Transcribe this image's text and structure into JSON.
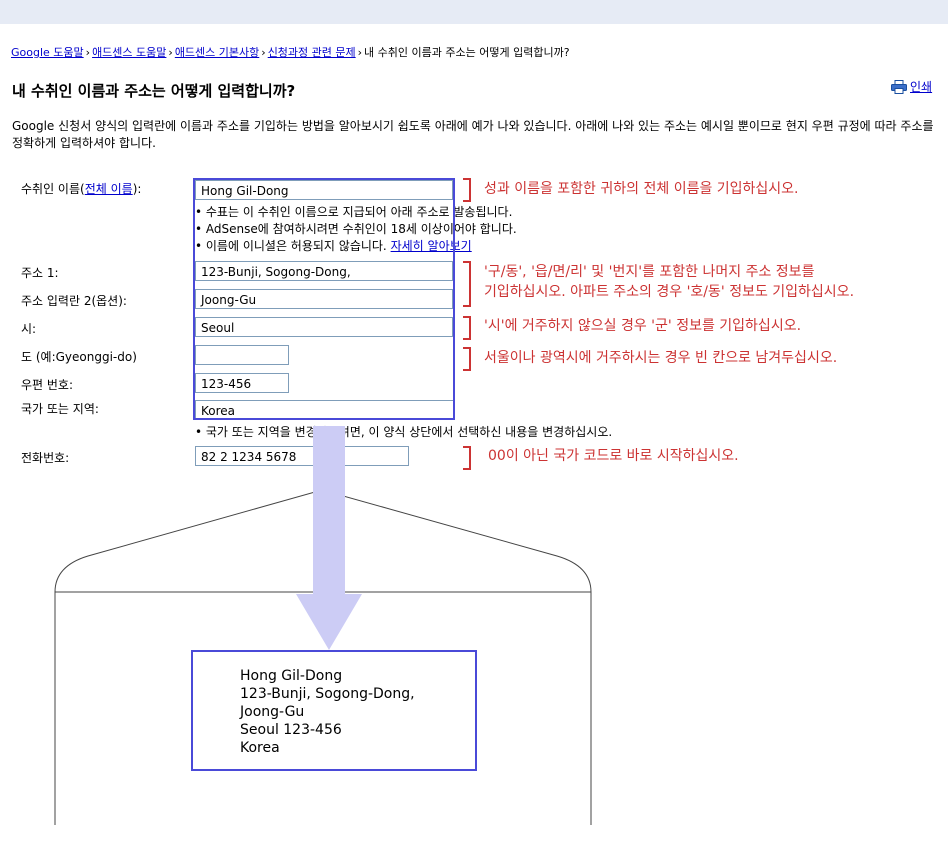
{
  "breadcrumb": {
    "items": [
      "Google 도움말",
      "애드센스 도움말",
      "애드센스 기본사항",
      "신청과정 관련 문제"
    ],
    "separator": "›",
    "current": "내 수취인 이름과 주소는 어떻게 입력합니까?"
  },
  "page_title": "내 수취인 이름과 주소는 어떻게 입력합니까?",
  "print_label": "인쇄",
  "intro": "Google 신청서 양식의 입력란에 이름과 주소를 기입하는 방법을 알아보시기 쉽도록 아래에 예가 나와 있습니다. 아래에 나와 있는 주소는 예시일 뿐이므로 현지 우편 규정에 따라 주소를 정확하게 입력하셔야 합니다.",
  "form": {
    "payee_label_prefix": "수취인 이름(",
    "payee_label_link": "전체 이름",
    "payee_label_suffix": "):",
    "payee_value": "Hong Gil-Dong",
    "payee_notes": [
      "• 수표는 이 수취인 이름으로 지급되어 아래 주소로 발송됩니다.",
      "• AdSense에 참여하시려면 수취인이 18세 이상이어야 합니다."
    ],
    "payee_note3": "• 이름에 이니셜은 허용되지 않습니다.",
    "learn_more": "자세히 알아보기",
    "address1_label": "주소 1:",
    "address1_value": "123-Bunji, Sogong-Dong,",
    "address2_label": "주소 입력란 2(옵션):",
    "address2_value": "Joong-Gu",
    "city_label": "시:",
    "city_value": "Seoul",
    "province_label": "도 (예:Gyeonggi-do)",
    "province_value": "",
    "zip_label": "우편 번호:",
    "zip_value": "123-456",
    "country_label": "국가 또는 지역:",
    "country_value": "Korea",
    "country_note": "• 국가 또는 지역을 변경하시려면, 이 양식 상단에서 선택하신 내용을 변경하십시오.",
    "phone_label": "전화번호:",
    "phone_value": "82 2 1234 5678"
  },
  "annotations": {
    "name": "성과 이름을 포함한 귀하의 전체 이름을 기입하십시오.",
    "address_line1": "'구/동', '읍/면/리' 및 '번지'를 포함한 나머지 주소 정보를",
    "address_line2": "기입하십시오. 아파트 주소의 경우 '호/동' 정보도 기입하십시오.",
    "city": "'시'에 거주하지 않으실 경우 '군' 정보를 기입하십시오.",
    "province": "서울이나 광역시에 거주하시는 경우 빈 칸으로 남겨두십시오.",
    "phone": "00이 아닌 국가 코드로 바로 시작하십시오."
  },
  "envelope": {
    "lines": [
      "Hong Gil-Dong",
      "123-Bunji, Sogong-Dong,",
      "Joong-Gu",
      "Seoul 123-456",
      "Korea"
    ]
  },
  "colors": {
    "link": "#0000cc",
    "annotation": "#cc3333",
    "highlight_border": "#4a4ad8",
    "arrow": "#ccccf5",
    "topbar": "#e6ebf5"
  }
}
